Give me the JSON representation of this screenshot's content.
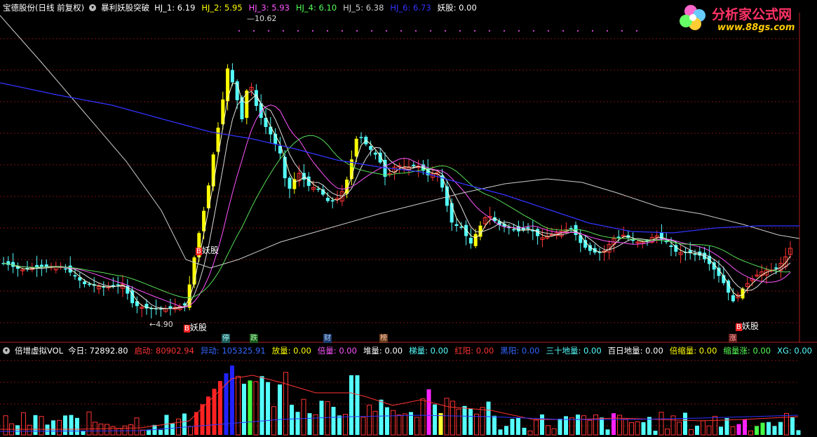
{
  "main_header": {
    "title": "宝德股份(日线 前复权)",
    "indicator_name": "暴利妖股突破",
    "items": [
      {
        "label": "HJ_1: 6.19",
        "color": "#ffffff"
      },
      {
        "label": "HJ_2: 5.95",
        "color": "#ffff00"
      },
      {
        "label": "HJ_3: 5.93",
        "color": "#ff55ff"
      },
      {
        "label": "HJ_4: 6.10",
        "color": "#55ff55"
      },
      {
        "label": "HJ_5: 6.38",
        "color": "#cccccc"
      },
      {
        "label": "HJ_6: 6.73",
        "color": "#3333ff"
      },
      {
        "label": "妖股: 0.00",
        "color": "#ffffff"
      }
    ]
  },
  "logo": {
    "brand": "分析家公式网",
    "url": "www.88gs.com"
  },
  "annotations": {
    "high_price": "10.62",
    "low_price": "4.90",
    "signal_1": "妖股",
    "signal_2": "妖股",
    "signal_3": "妖股",
    "b_mark": "B"
  },
  "event_tags": [
    "停",
    "跌",
    "财",
    "榜",
    "涨"
  ],
  "volume_header": {
    "indicator_name": "倍增虚拟VOL",
    "items": [
      {
        "label": "今日: 72892.80",
        "color": "#ffffff"
      },
      {
        "label": "启动: 80902.94",
        "color": "#ff3333"
      },
      {
        "label": "异动: 105325.91",
        "color": "#3366ff"
      },
      {
        "label": "放量: 0.00",
        "color": "#ffff00"
      },
      {
        "label": "倍量: 0.00",
        "color": "#ff55ff"
      },
      {
        "label": "堆量: 0.00",
        "color": "#ffffff"
      },
      {
        "label": "梯量: 0.00",
        "color": "#55ffff"
      },
      {
        "label": "红阳: 0.00",
        "color": "#ff3333"
      },
      {
        "label": "黑阳: 0.00",
        "color": "#3366ff"
      },
      {
        "label": "三十地量: 0.00",
        "color": "#55ffff"
      },
      {
        "label": "百日地量: 0.00",
        "color": "#ffffff"
      },
      {
        "label": "倍缩量: 0.00",
        "color": "#ffff00"
      },
      {
        "label": "缩量涨: 0.00",
        "color": "#55ff55"
      },
      {
        "label": "XG: 0.00",
        "color": "#55ffff"
      }
    ]
  },
  "colors": {
    "background": "#000000",
    "grid": "#7a1010",
    "up_candle": "#ff3333",
    "down_candle": "#55ffff",
    "strong_up": "#ffff00",
    "ma_long": "#3333ff"
  }
}
